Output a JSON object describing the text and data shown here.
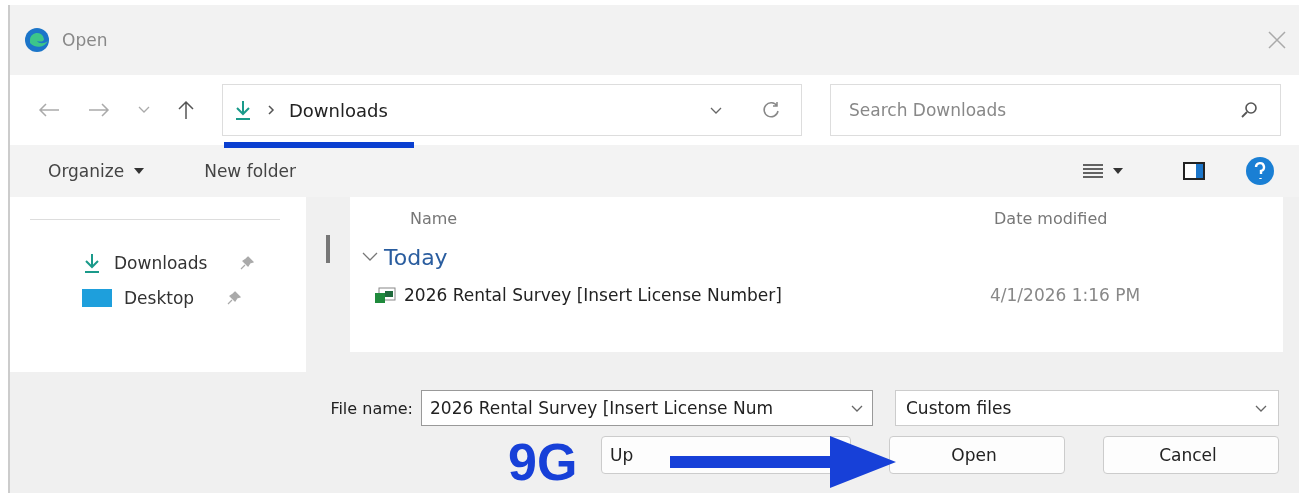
{
  "window": {
    "title": "Open"
  },
  "address": {
    "location": "Downloads"
  },
  "search": {
    "placeholder": "Search Downloads"
  },
  "commands": [
    "Organize",
    "New folder"
  ],
  "sidebar": {
    "items": [
      {
        "label": "Downloads"
      },
      {
        "label": "Desktop"
      }
    ]
  },
  "columns": [
    "Name",
    "Date modified"
  ],
  "groups": [
    {
      "label": "Today",
      "expanded": true,
      "files": [
        {
          "name": "2026 Rental Survey [Insert License Number]",
          "date": "4/1/2026 1:16 PM"
        }
      ]
    }
  ],
  "file_name": {
    "label": "File name:",
    "value": "2026 Rental Survey [Insert License Num"
  },
  "file_type": {
    "value": "Custom files"
  },
  "buttons": [
    {
      "label": "Up",
      "kind": "covered"
    },
    {
      "label": "Open",
      "kind": "action"
    },
    {
      "label": "Cancel",
      "kind": "action"
    }
  ],
  "annotation": {
    "label": "9G"
  }
}
